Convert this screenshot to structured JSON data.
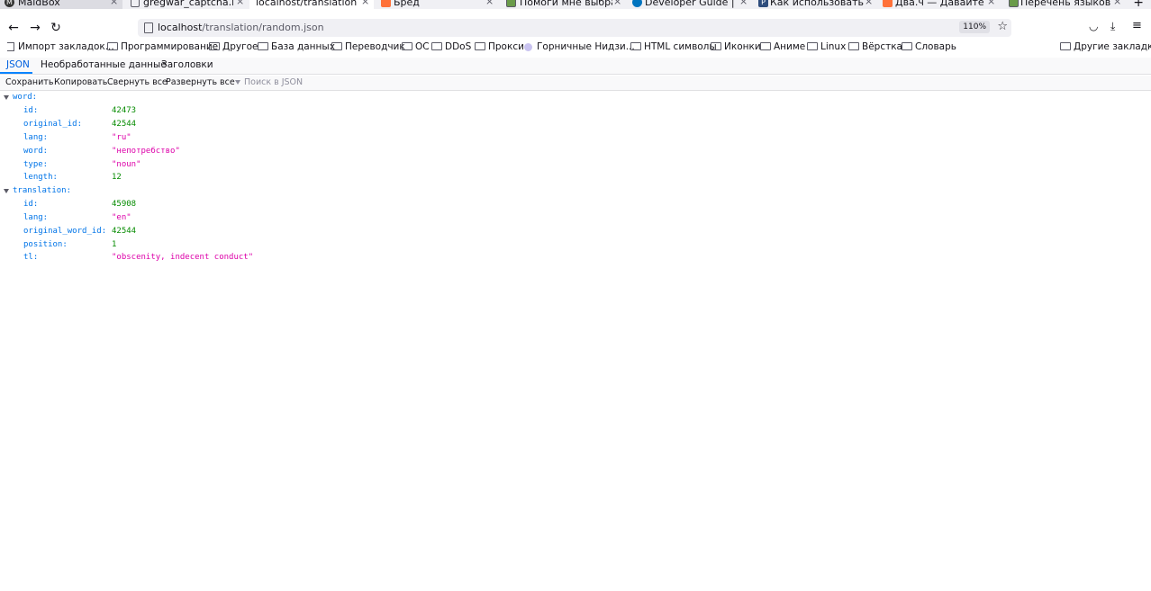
{
  "tabs": [
    {
      "title": "MaidBox",
      "icon": "gmail-icon",
      "close": "×"
    },
    {
      "title": "gregwar_captcha.html",
      "icon": "page-icon",
      "close": "×"
    },
    {
      "title": "localhost/translation/random",
      "icon": "",
      "close": "×"
    },
    {
      "title": "Бред",
      "icon": "orange-icon",
      "close": "×"
    },
    {
      "title": "Помоги мне выбрать",
      "icon": "image-icon",
      "close": "×"
    },
    {
      "title": "Developer Guide | hCaptcha",
      "icon": "hcaptcha-icon",
      "close": "×"
    },
    {
      "title": "Как использовать hCaptcha",
      "icon": "p-icon",
      "close": "×"
    },
    {
      "title": "Два.ч — Давайте при",
      "icon": "orange-icon",
      "close": "×"
    },
    {
      "title": "Перечень языков — Википедия",
      "icon": "image-icon",
      "close": "×"
    }
  ],
  "new_tab": "+",
  "nav": {
    "back": "←",
    "forward": "→",
    "reload": "↻",
    "url_host": "localhost",
    "url_path": "/translation/random.json",
    "zoom": "110%",
    "star": "☆",
    "pocket": "◡",
    "download": "⤓",
    "menu": "≡"
  },
  "bookmarks": [
    {
      "label": "Импорт закладок...",
      "icon": "import-icon"
    },
    {
      "label": "Программирование",
      "icon": "folder-icon"
    },
    {
      "label": "Другое",
      "icon": "folder-icon"
    },
    {
      "label": "База данных",
      "icon": "folder-icon"
    },
    {
      "label": "Переводчик",
      "icon": "folder-icon"
    },
    {
      "label": "ОС",
      "icon": "folder-icon"
    },
    {
      "label": "DDoS",
      "icon": "folder-icon"
    },
    {
      "label": "Прокси",
      "icon": "folder-icon"
    },
    {
      "label": "Горничные Нидзи...",
      "icon": "circle-icon"
    },
    {
      "label": "HTML символы",
      "icon": "folder-icon"
    },
    {
      "label": "Иконки",
      "icon": "folder-icon"
    },
    {
      "label": "Аниме",
      "icon": "folder-icon"
    },
    {
      "label": "Linux",
      "icon": "folder-icon"
    },
    {
      "label": "Вёрстка",
      "icon": "folder-icon"
    },
    {
      "label": "Словарь",
      "icon": "folder-icon"
    }
  ],
  "other_bookmarks": "Другие закладки",
  "viewer_tabs": [
    "JSON",
    "Необработанные данные",
    "Заголовки"
  ],
  "toolbar": {
    "save": "Сохранить",
    "copy": "Копировать",
    "collapse": "Свернуть все",
    "expand": "Развернуть все",
    "filter_placeholder": "Поиск в JSON"
  },
  "json": {
    "word_key": "word:",
    "word": [
      {
        "key": "id:",
        "value": "42473",
        "type": "num"
      },
      {
        "key": "original_id:",
        "value": "42544",
        "type": "num"
      },
      {
        "key": "lang:",
        "value": "\"ru\"",
        "type": "str"
      },
      {
        "key": "word:",
        "value": "\"непотребство\"",
        "type": "str"
      },
      {
        "key": "type:",
        "value": "\"noun\"",
        "type": "str"
      },
      {
        "key": "length:",
        "value": "12",
        "type": "num"
      }
    ],
    "translation_key": "translation:",
    "translation": [
      {
        "key": "id:",
        "value": "45908",
        "type": "num"
      },
      {
        "key": "lang:",
        "value": "\"en\"",
        "type": "str"
      },
      {
        "key": "original_word_id:",
        "value": "42544",
        "type": "num"
      },
      {
        "key": "position:",
        "value": "1",
        "type": "num"
      },
      {
        "key": "tl:",
        "value": "\"obscenity, indecent conduct\"",
        "type": "str"
      }
    ]
  }
}
